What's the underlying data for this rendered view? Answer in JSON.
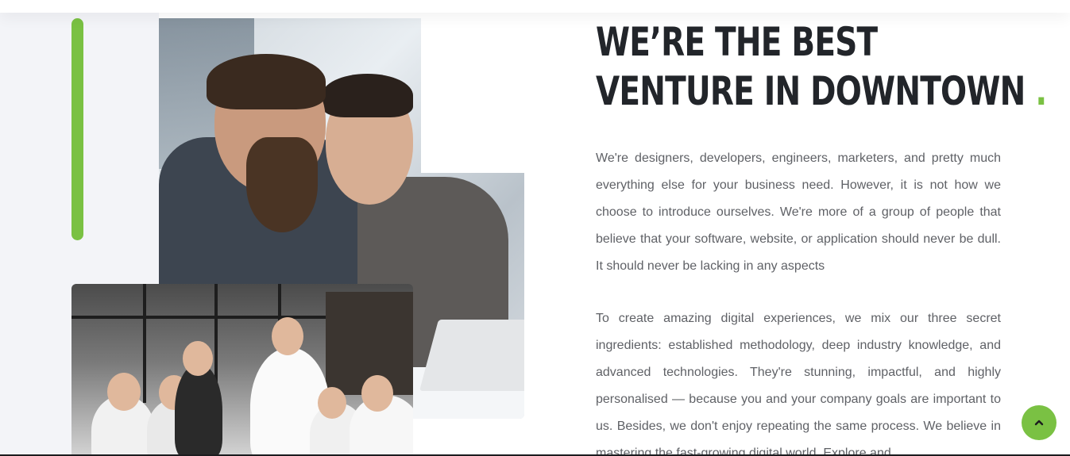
{
  "about": {
    "heading_line1": "WE’RE THE BEST",
    "heading_line2": "VENTURE IN DOWNTOWN",
    "heading_dot": ".",
    "paragraph1": "We're designers, developers, engineers, marketers, and pretty much everything else for your business need. However, it is not how we choose to introduce ourselves. We're more of a group of people that believe that your software, website, or application should never be dull. It should never be lacking in any aspects",
    "paragraph2": "To create amazing digital experiences, we mix our three secret ingredients: established methodology, deep industry knowledge, and advanced technologies. They're stunning, impactful, and highly personalised — because you and your company goals are important to us. Besides, we don't enjoy repeating the same process. We believe in mastering the fast-growing digital world. Explore and"
  },
  "images": {
    "main_photo": "two-men-working-on-laptop-photo",
    "team_photo": "team-high-five-photo"
  },
  "scroll_top": {
    "icon": "chevron-up-icon"
  },
  "colors": {
    "accent": "#7ac143",
    "heading": "#22252a",
    "body_text": "#5f6166",
    "left_panel": "#f3f4f8"
  }
}
